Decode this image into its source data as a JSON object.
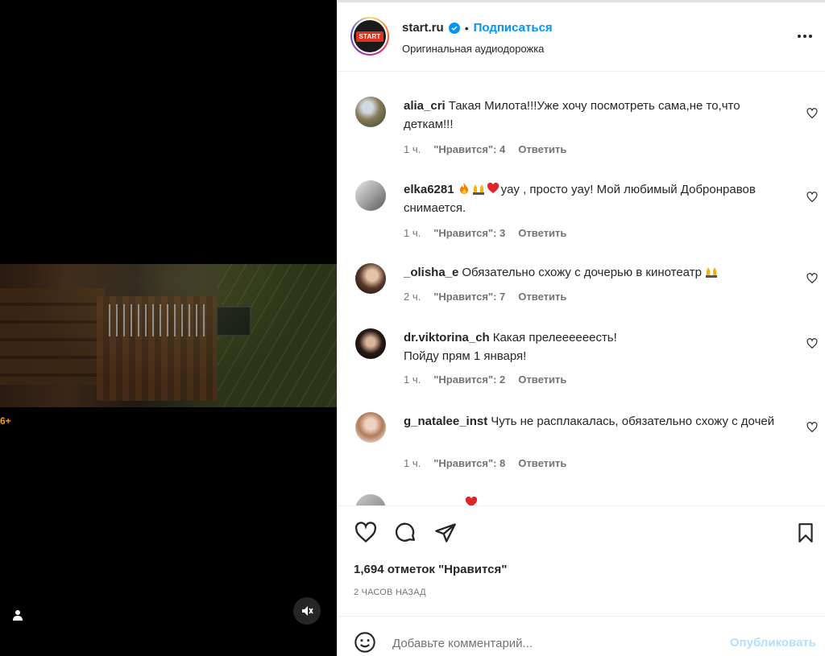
{
  "video": {
    "age_rating": "6+"
  },
  "post": {
    "username": "start.ru",
    "follow_label": "Подписаться",
    "audio_label": "Оригинальная аудиодорожка",
    "avatar_logo_text": "START",
    "likes_text": "1,694 отметок \"Нравится\"",
    "time_ago": "2 ЧАСОВ НАЗАД"
  },
  "comments": [
    {
      "username": "alia_cri",
      "text": "Такая Милота!!!Уже хочу посмотреть сама,не то,что деткам!!!",
      "time": "1 ч.",
      "likes": "\"Нравится\": 4",
      "reply": "Ответить"
    },
    {
      "username": "elka6281",
      "text": "yay , просто yay! Мой любимый Добронравов снимается.",
      "time": "1 ч.",
      "likes": "\"Нравится\": 3",
      "reply": "Ответить"
    },
    {
      "username": "_olisha_e",
      "text": "Обязательно схожу с дочерью в кинотеатр",
      "time": "2 ч.",
      "likes": "\"Нравится\": 7",
      "reply": "Ответить"
    },
    {
      "username": "dr.viktorina_ch",
      "text": "Какая прелеееееесть!",
      "text2": "Пойду прям 1 января!",
      "time": "1 ч.",
      "likes": "\"Нравится\": 2",
      "reply": "Ответить"
    },
    {
      "username": "g_natalee_inst",
      "text": "Чуть не расплакалась, обязательно схожу с дочей",
      "time": "1 ч.",
      "likes": "\"Нравится\": 8",
      "reply": "Ответить"
    }
  ],
  "add_comment": {
    "placeholder": "Добавьте комментарий...",
    "publish_label": "Опубликовать"
  },
  "colors": {
    "accent": "#0095f6",
    "publish_disabled": "#b2dffc",
    "heart_red": "#e0242c"
  }
}
